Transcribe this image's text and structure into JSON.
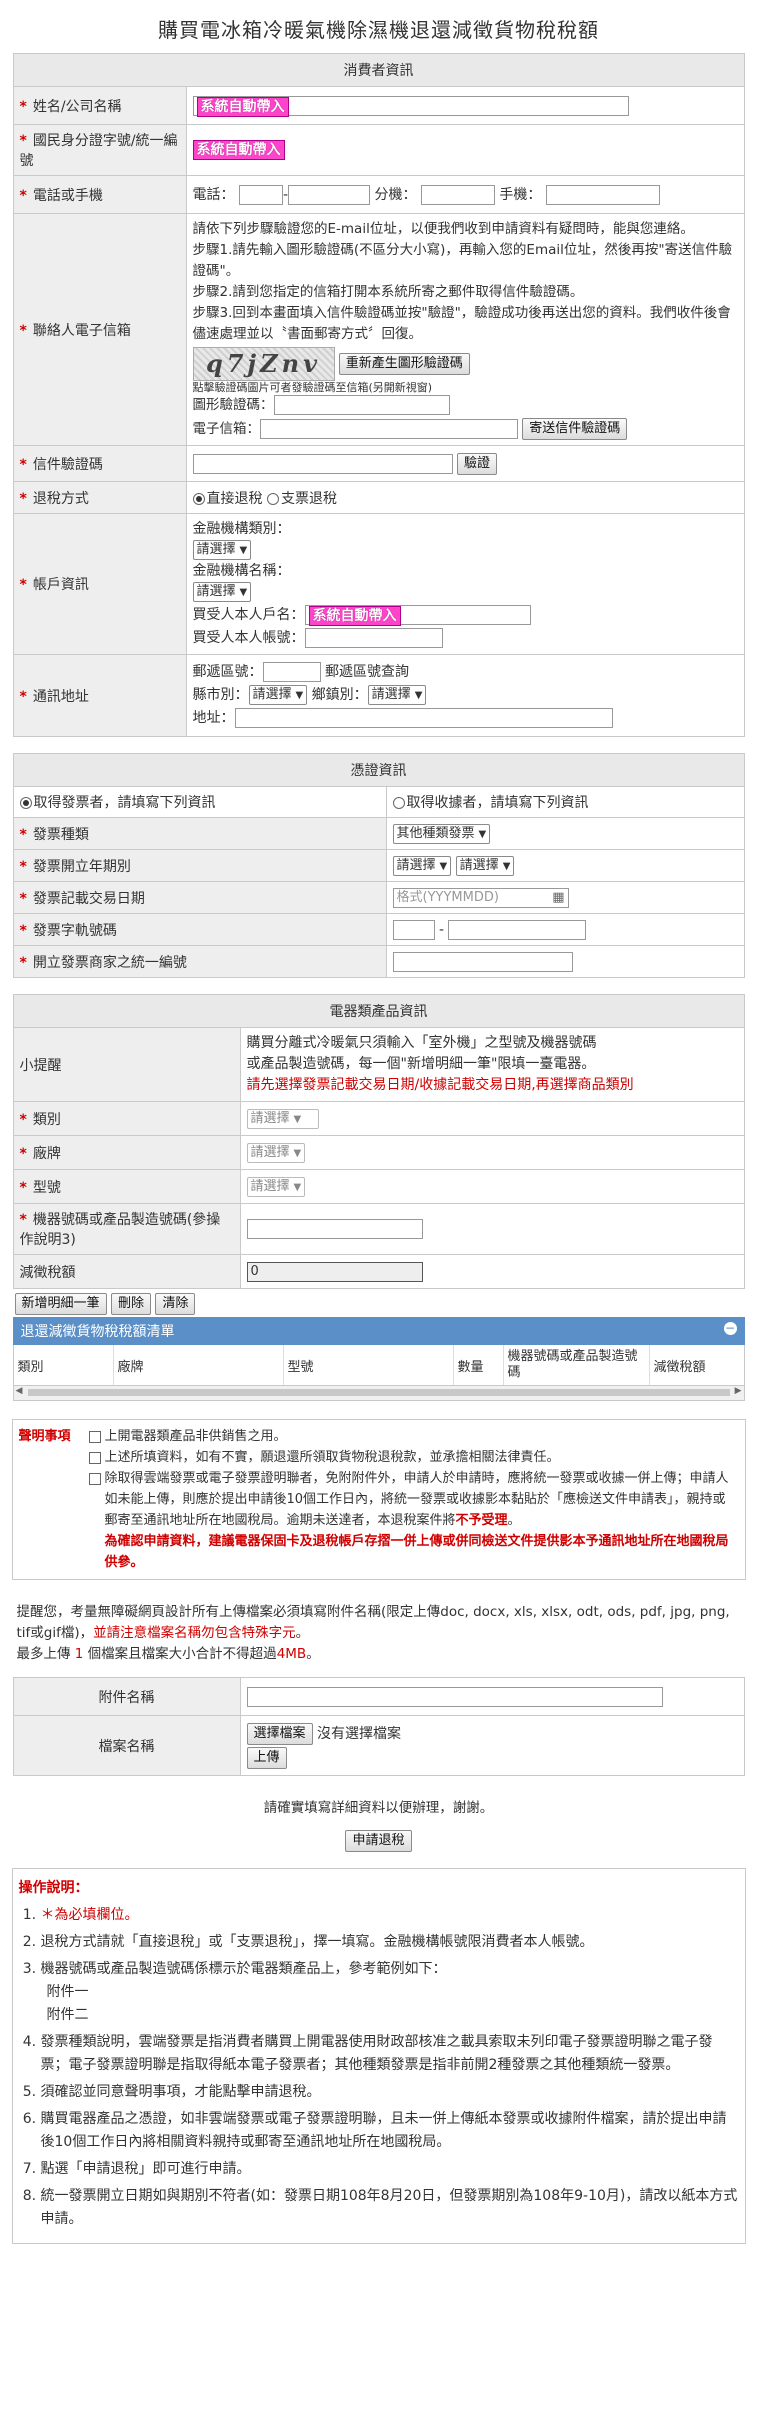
{
  "page": {
    "title": "購買電冰箱冷暖氣機除濕機退還減徵貨物稅稅額"
  },
  "auto_fill": "系統自動帶入",
  "consumer": {
    "section_title": "消費者資訊",
    "name_label": "姓名/公司名稱",
    "id_label": "國民身分證字號/統一編號",
    "phone_label": "電話或手機",
    "phone_tel": "電話：",
    "phone_ext": "分機：",
    "phone_mobile": "手機：",
    "email_label": "聯絡人電子信箱",
    "email_help": [
      "請依下列步驟驗證您的E-mail位址，以便我們收到申請資料有疑問時，能與您連絡。",
      "步驟1.請先輸入圖形驗證碼(不區分大小寫)，再輸入您的Email位址，然後再按\"寄送信件驗證碼\"。",
      "步驟2.請到您指定的信箱打開本系統所寄之郵件取得信件驗證碼。",
      "步驟3.回到本畫面填入信件驗證碼並按\"驗證\"，驗證成功後再送出您的資料。我們收件後會儘速處理並以〝書面郵寄方式〞回復。"
    ],
    "captcha_text": "q7jZnv",
    "regen_captcha": "重新產生圖形驗證碼",
    "captcha_hint": "點擊驗證碼圖片可者發驗證碼至信箱(另開新視窗)",
    "captcha_input_label": "圖形驗證碼：",
    "email_input_label": "電子信箱：",
    "send_code": "寄送信件驗證碼",
    "verify_label": "信件驗證碼",
    "verify_btn": "驗證",
    "refund_label": "退稅方式",
    "refund_opt1": "直接退稅",
    "refund_opt2": "支票退稅",
    "account_label": "帳戶資訊",
    "bank_type_label": "金融機構類別：",
    "bank_name_label": "金融機構名稱：",
    "select_default": "請選擇",
    "holder_label": "買受人本人戶名：",
    "account_no_label": "買受人本人帳號：",
    "address_label": "通訊地址",
    "zip_label": "郵遞區號：",
    "zip_query": "郵遞區號查詢",
    "city_label": "縣市別：",
    "town_label": "鄉鎮別：",
    "addr_label": "地址："
  },
  "invoice": {
    "section_title": "憑證資訊",
    "opt_issuer": "取得發票者，請填寫下列資訊",
    "opt_receipt": "取得收據者，請填寫下列資訊",
    "type_label": "發票種類",
    "type_value": "其他種類發票",
    "period_label": "發票開立年期別",
    "date_label": "發票記載交易日期",
    "date_placeholder": "格式(YYYMMDD)",
    "number_label": "發票字軌號碼",
    "number_dash": "-",
    "seller_label": "開立發票商家之統一編號"
  },
  "product": {
    "section_title": "電器類產品資訊",
    "tip_label": "小提醒",
    "tip_text1": "購買分離式冷暖氣只須輸入「室外機」之型號及機器號碼",
    "tip_text2": "或產品製造號碼，每一個\"新增明細一筆\"限填一臺電器。",
    "tip_red": "請先選擇發票記載交易日期/收據記載交易日期,再選擇商品類別",
    "category_label": "類別",
    "brand_label": "廠牌",
    "model_label": "型號",
    "serial_label": "機器號碼或產品製造號碼(參操作說明3)",
    "tax_label": "減徵稅額",
    "tax_value": "0",
    "add_btn": "新增明細一筆",
    "delete_btn": "刪除",
    "clear_btn": "清除",
    "list_title": "退還減徵貨物稅稅額清單",
    "columns": [
      "類別",
      "廠牌",
      "型號",
      "數量",
      "機器號碼或產品製造號碼",
      "減徵稅額"
    ]
  },
  "declaration": {
    "title": "聲明事項",
    "item1": "上開電器類產品非供銷售之用。",
    "item2": "上述所填資料，如有不實，願退還所領取貨物稅退稅款，並承擔相關法律責任。",
    "item3": "除取得雲端發票或電子發票證明聯者，免附附件外，申請人於申請時，應將統一發票或收據一併上傳；申請人如未能上傳，則應於提出申請後10個工作日內，將統一發票或收據影本黏貼於「應檢送文件申請表」，親持或郵寄至通訊地址所在地國稅局。逾期未送達者，本退稅案件將",
    "item3_red": "不予受理",
    "item3_end": "。",
    "item3_bold": "為確認申請資料，建議電器保固卡及退稅帳戶存摺一併上傳或併同檢送文件提供影本予通訊地址所在地國稅局供參。"
  },
  "upload": {
    "note1": "提醒您，考量無障礙網頁設計所有上傳檔案必須填寫附件名稱(限定上傳doc, docx, xls, xlsx, odt, ods, pdf, jpg, png, tif或gif檔)，",
    "note1_red": "並請注意檔案名稱勿包含特殊字元",
    "note1_end": "。",
    "note2_a": "最多上傳 ",
    "note2_num": "1",
    "note2_b": " 個檔案且檔案大小合計不得超過",
    "note2_size": "4MB",
    "note2_c": "。",
    "attach_label": "附件名稱",
    "file_label": "檔案名稱",
    "choose_btn": "選擇檔案",
    "no_file": "沒有選擇檔案",
    "upload_btn": "上傳"
  },
  "submit": {
    "hint": "請確實填寫詳細資料以便辦理，謝謝。",
    "button": "申請退稅"
  },
  "ops": {
    "title": "操作說明：",
    "items": [
      "＊為必填欄位。",
      "退稅方式請就「直接退稅」或「支票退稅」，擇一填寫。金融機構帳號限消費者本人帳號。",
      "機器號碼或產品製造號碼係標示於電器類產品上，參考範例如下：",
      "發票種類說明，雲端發票是指消費者購買上開電器使用財政部核准之載具索取未列印電子發票證明聯之電子發票；電子發票證明聯是指取得紙本電子發票者；其他種類發票是指非前開2種發票之其他種類統一發票。",
      "須確認並同意聲明事項，才能點擊申請退稅。",
      "購買電器產品之憑證，如非雲端發票或電子發票證明聯，且未一併上傳紙本發票或收據附件檔案，請於提出申請後10個工作日內將相關資料親持或郵寄至通訊地址所在地國稅局。",
      "點選「申請退稅」即可進行申請。",
      "統一發票開立日期如與期別不符者(如：發票日期108年8月20日，但發票期別為108年9-10月)，請改以紙本方式申請。"
    ],
    "annex1": "附件一",
    "annex2": "附件二"
  },
  "colors": {
    "accent_bar": "#5b8fc7",
    "required": "#d00000",
    "auto_fill": "#ff44cc"
  }
}
